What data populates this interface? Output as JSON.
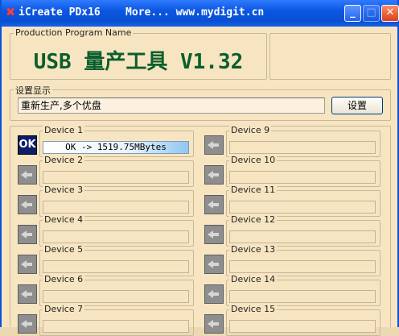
{
  "window": {
    "title": "iCreate PDx16    More... www.mydigit.cn",
    "minimize": "_",
    "maximize": "□",
    "close": "✕"
  },
  "program": {
    "legend": "Production Program Name",
    "name": "USB 量产工具 V1.32"
  },
  "settings": {
    "legend": "设置显示",
    "status": "重新生产,多个优盘",
    "button_label": "设置"
  },
  "devices_left": [
    {
      "label": "Device 1",
      "status": "OK",
      "result": "OK -> 1519.75MBytes"
    },
    {
      "label": "Device 2",
      "status": "idle",
      "result": ""
    },
    {
      "label": "Device 3",
      "status": "idle",
      "result": ""
    },
    {
      "label": "Device 4",
      "status": "idle",
      "result": ""
    },
    {
      "label": "Device 5",
      "status": "idle",
      "result": ""
    },
    {
      "label": "Device 6",
      "status": "idle",
      "result": ""
    },
    {
      "label": "Device 7",
      "status": "idle",
      "result": ""
    }
  ],
  "devices_right": [
    {
      "label": "Device 9",
      "status": "idle",
      "result": ""
    },
    {
      "label": "Device 10",
      "status": "idle",
      "result": ""
    },
    {
      "label": "Device 11",
      "status": "idle",
      "result": ""
    },
    {
      "label": "Device 12",
      "status": "idle",
      "result": ""
    },
    {
      "label": "Device 13",
      "status": "idle",
      "result": ""
    },
    {
      "label": "Device 14",
      "status": "idle",
      "result": ""
    },
    {
      "label": "Device 15",
      "status": "idle",
      "result": ""
    }
  ],
  "colors": {
    "window_bg": "#f7e5c2",
    "titlebar": "#0a4fd1",
    "title_text": "#0b5f2c",
    "ok_indicator": "#0c1d69",
    "idle_indicator": "#8e8e8e"
  }
}
